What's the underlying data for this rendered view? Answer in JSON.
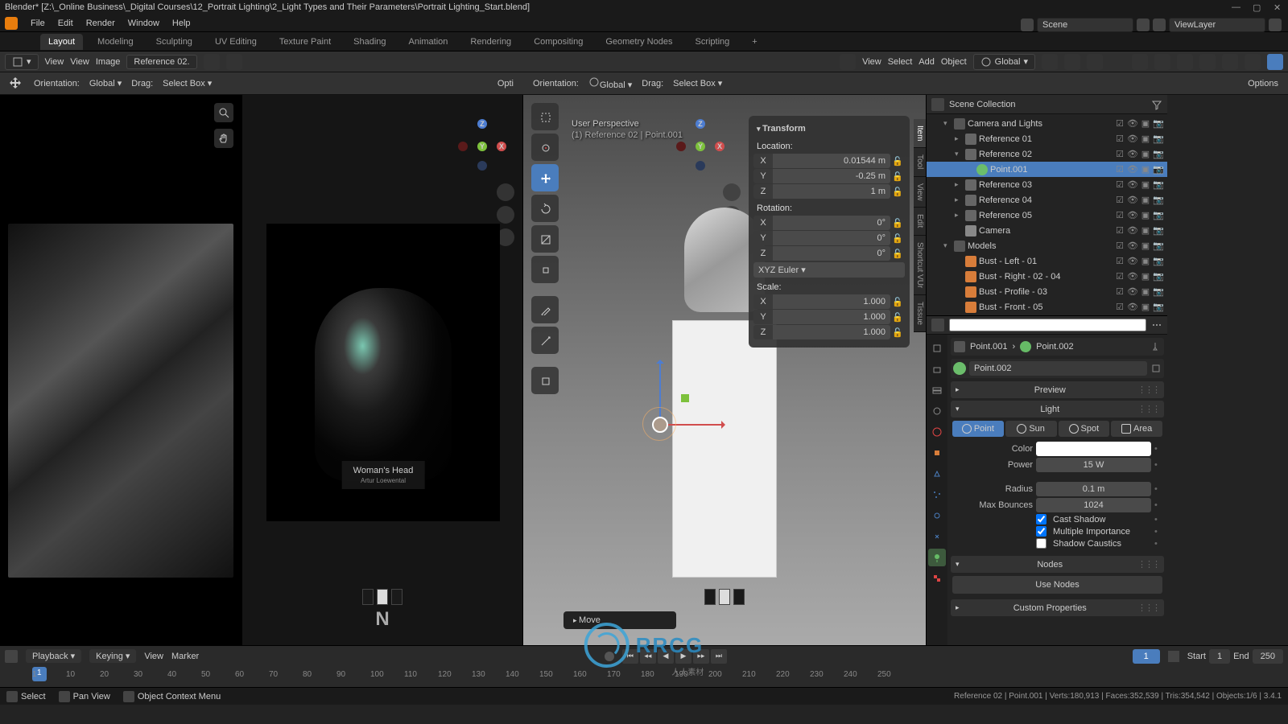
{
  "window": {
    "title": "Blender* [Z:\\_Online Business\\_Digital Courses\\12_Portrait Lighting\\2_Light Types and Their Parameters\\Portrait Lighting_Start.blend]"
  },
  "menu": {
    "file": "File",
    "edit": "Edit",
    "render": "Render",
    "window": "Window",
    "help": "Help"
  },
  "workspace_tabs": {
    "layout": "Layout",
    "modeling": "Modeling",
    "sculpting": "Sculpting",
    "uv": "UV Editing",
    "texture": "Texture Paint",
    "shading": "Shading",
    "animation": "Animation",
    "rendering": "Rendering",
    "compositing": "Compositing",
    "geometry": "Geometry Nodes",
    "scripting": "Scripting"
  },
  "scene_selector": {
    "scene": "Scene",
    "viewlayer": "ViewLayer"
  },
  "image_editor": {
    "view": "View",
    "image": "Image",
    "reference": "Reference 02.",
    "view_menu": "View"
  },
  "tool_header_left": {
    "orientation_label": "Orientation:",
    "orientation_value": "Global",
    "drag_label": "Drag:",
    "drag_value": "Select Box",
    "options": "Opti"
  },
  "tool_header_right": {
    "orientation_label": "Orientation:",
    "orientation_value": "Global",
    "drag_label": "Drag:",
    "drag_value": "Select Box",
    "options": "Options"
  },
  "header2": {
    "view": "View",
    "select": "Select",
    "add": "Add",
    "object": "Object",
    "global": "Global"
  },
  "viewport_mid": {
    "render_label": "Woman's Head",
    "render_credit": "Artur Loewental",
    "keycast": "N"
  },
  "viewport_right": {
    "perspective": "User Perspective",
    "context": "(1) Reference 02 | Point.001",
    "move_popup": "Move"
  },
  "transform_panel": {
    "title": "Transform",
    "location": "Location:",
    "loc_x": "0.01544 m",
    "loc_y": "-0.25 m",
    "loc_z": "1 m",
    "rotation": "Rotation:",
    "rot_x": "0°",
    "rot_y": "0°",
    "rot_z": "0°",
    "rot_mode": "XYZ Euler",
    "scale": "Scale:",
    "scale_x": "1.000",
    "scale_y": "1.000",
    "scale_z": "1.000"
  },
  "side_tabs": {
    "item": "Item",
    "tool": "Tool",
    "view": "View",
    "edit": "Edit",
    "shortcut": "Shortcut VUr",
    "tissue": "Tissue"
  },
  "outliner": {
    "scene_collection": "Scene Collection",
    "items": [
      {
        "label": "Camera and Lights",
        "type": "collection",
        "indent": 1,
        "expanded": true
      },
      {
        "label": "Reference 01",
        "type": "empty",
        "indent": 2
      },
      {
        "label": "Reference 02",
        "type": "empty",
        "indent": 2,
        "expanded": true
      },
      {
        "label": "Point.001",
        "type": "light",
        "indent": 3,
        "selected": true
      },
      {
        "label": "Reference 03",
        "type": "empty",
        "indent": 2
      },
      {
        "label": "Reference 04",
        "type": "empty",
        "indent": 2
      },
      {
        "label": "Reference 05",
        "type": "empty",
        "indent": 2
      },
      {
        "label": "Camera",
        "type": "camera",
        "indent": 2
      },
      {
        "label": "Models",
        "type": "collection",
        "indent": 1,
        "expanded": true
      },
      {
        "label": "Bust - Left - 01",
        "type": "mesh",
        "indent": 2
      },
      {
        "label": "Bust - Right - 02 - 04",
        "type": "mesh",
        "indent": 2
      },
      {
        "label": "Bust - Profile - 03",
        "type": "mesh",
        "indent": 2
      },
      {
        "label": "Bust - Front - 05",
        "type": "mesh",
        "indent": 2
      }
    ]
  },
  "properties": {
    "breadcrumb_obj": "Point.001",
    "breadcrumb_data": "Point.002",
    "datablock": "Point.002",
    "preview": "Preview",
    "light": "Light",
    "types": {
      "point": "Point",
      "sun": "Sun",
      "spot": "Spot",
      "area": "Area"
    },
    "color_label": "Color",
    "power_label": "Power",
    "power_value": "15 W",
    "radius_label": "Radius",
    "radius_value": "0.1 m",
    "bounces_label": "Max Bounces",
    "bounces_value": "1024",
    "cast_shadow": "Cast Shadow",
    "multiple_importance": "Multiple Importance",
    "shadow_caustics": "Shadow Caustics",
    "nodes": "Nodes",
    "use_nodes": "Use Nodes",
    "custom_props": "Custom Properties"
  },
  "timeline": {
    "playback": "Playback",
    "keying": "Keying",
    "view": "View",
    "marker": "Marker",
    "current_frame": "1",
    "start_label": "Start",
    "start_value": "1",
    "end_label": "End",
    "end_value": "250",
    "ticks": [
      "1",
      "10",
      "20",
      "30",
      "40",
      "50",
      "60",
      "70",
      "80",
      "90",
      "100",
      "110",
      "120",
      "130",
      "140",
      "150",
      "160",
      "170",
      "180",
      "190",
      "200",
      "210",
      "220",
      "230",
      "240",
      "250"
    ]
  },
  "status_bar": {
    "select": "Select",
    "pan": "Pan View",
    "context_menu": "Object Context Menu",
    "stats": "Reference 02 | Point.001 | Verts:180,913 | Faces:352,539 | Tris:354,542 | Objects:1/6 | 3.4.1"
  },
  "watermark": {
    "text": "RRCG",
    "sub": "人人素材"
  }
}
